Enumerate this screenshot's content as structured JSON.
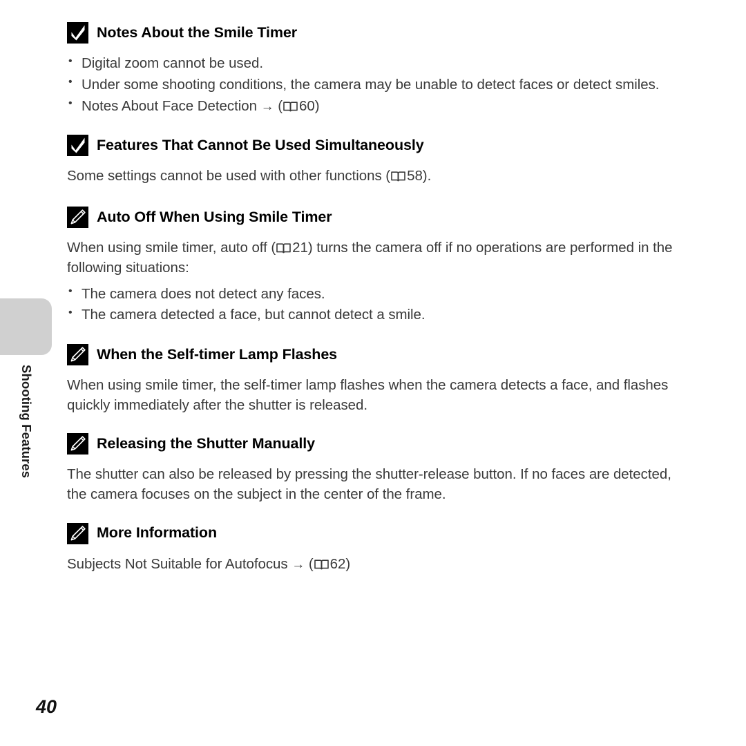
{
  "page": {
    "number": "40",
    "side_tab_label": "Shooting Features"
  },
  "icons": {
    "check": "check-mark-icon",
    "pencil": "pencil-icon",
    "book": "open-book-icon",
    "arrow": "→"
  },
  "sections": [
    {
      "id": "notes-about-the-smile-timer",
      "icon": "check",
      "title": "Notes About the Smile Timer",
      "bullets": [
        {
          "text": "Digital zoom cannot be used."
        },
        {
          "text": "Under some shooting conditions, the camera may be unable to detect faces or detect smiles."
        },
        {
          "pre": "Notes About Face Detection ",
          "arrow": "→",
          "open_paren": " (",
          "ref": "60",
          "close_paren": ")"
        }
      ]
    },
    {
      "id": "features-that-cannot-be-used-simultaneously",
      "icon": "check",
      "title": "Features That Cannot Be Used Simultaneously",
      "paragraph": {
        "pre": "Some settings cannot be used with other functions (",
        "ref": "58",
        "post": ")."
      }
    },
    {
      "id": "auto-off-when-using-smile-timer",
      "icon": "pencil",
      "title": "Auto Off When Using Smile Timer",
      "paragraph": {
        "pre": "When using smile timer, auto off (",
        "ref": "21",
        "post": ") turns the camera off if no operations are performed in the following situations:"
      },
      "bullets": [
        {
          "text": "The camera does not detect any faces."
        },
        {
          "text": "The camera detected a face, but cannot detect a smile."
        }
      ]
    },
    {
      "id": "when-the-self-timer-lamp-flashes",
      "icon": "pencil",
      "title": "When the Self-timer Lamp Flashes",
      "paragraph": {
        "pre": "When using smile timer, the self-timer lamp flashes when the camera detects a face, and flashes quickly immediately after the shutter is released."
      }
    },
    {
      "id": "releasing-the-shutter-manually",
      "icon": "pencil",
      "title": "Releasing the Shutter Manually",
      "paragraph": {
        "pre": "The shutter can also be released by pressing the shutter-release button. If no faces are detected, the camera focuses on the subject in the center of the frame."
      }
    },
    {
      "id": "more-information",
      "icon": "pencil",
      "title": "More Information",
      "paragraph": {
        "pre": "Subjects Not Suitable for Autofocus ",
        "arrow": "→",
        "open_paren": " (",
        "ref": "62",
        "close_paren": ")"
      }
    }
  ]
}
